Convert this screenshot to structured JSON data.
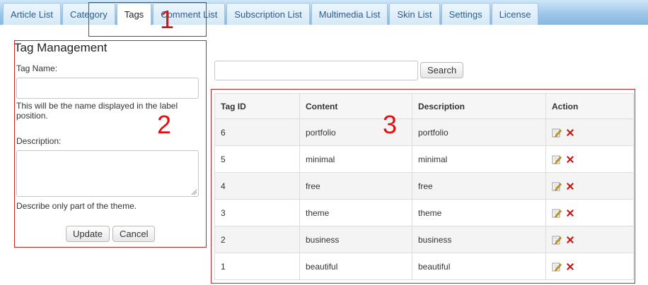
{
  "tabs": [
    {
      "label": "Article List",
      "active": false
    },
    {
      "label": "Category",
      "active": false
    },
    {
      "label": "Tags",
      "active": true
    },
    {
      "label": "Comment List",
      "active": false
    },
    {
      "label": "Subscription List",
      "active": false
    },
    {
      "label": "Multimedia List",
      "active": false
    },
    {
      "label": "Skin List",
      "active": false
    },
    {
      "label": "Settings",
      "active": false
    },
    {
      "label": "License",
      "active": false
    }
  ],
  "annotations": [
    "1",
    "2",
    "3"
  ],
  "form": {
    "title": "Tag Management",
    "tag_name_label": "Tag Name:",
    "tag_name_value": "",
    "tag_name_hint": "This will be the name displayed in the label position.",
    "description_label": "Description:",
    "description_value": "",
    "description_hint": "Describe only part of the theme.",
    "update_label": "Update",
    "cancel_label": "Cancel"
  },
  "search": {
    "value": "",
    "button_label": "Search"
  },
  "table": {
    "headers": [
      "Tag ID",
      "Content",
      "Description",
      "Action"
    ],
    "rows": [
      {
        "id": "6",
        "content": "portfolio",
        "description": "portfolio"
      },
      {
        "id": "5",
        "content": "minimal",
        "description": "minimal"
      },
      {
        "id": "4",
        "content": "free",
        "description": "free"
      },
      {
        "id": "3",
        "content": "theme",
        "description": "theme"
      },
      {
        "id": "2",
        "content": "business",
        "description": "business"
      },
      {
        "id": "1",
        "content": "beautiful",
        "description": "beautiful"
      }
    ]
  },
  "icons": {
    "edit": "edit-icon",
    "delete": "delete-icon"
  },
  "colors": {
    "tabbar": "#9cc5e8",
    "annotation": "#e01010",
    "delete": "#c81414",
    "edit": "#d9a21b"
  }
}
